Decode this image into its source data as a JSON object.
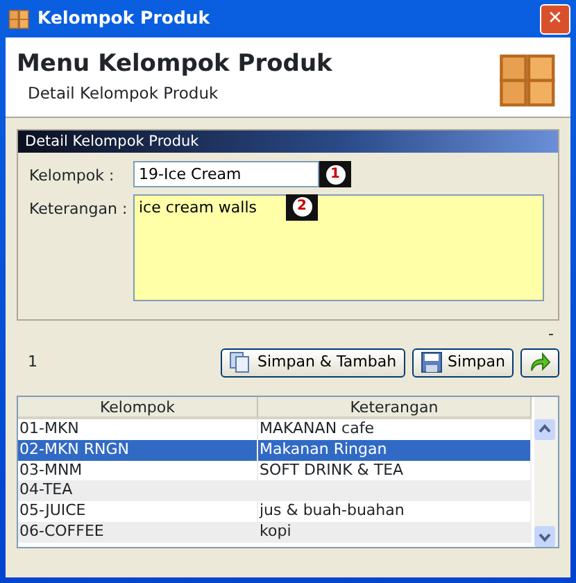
{
  "window": {
    "title": "Kelompok Produk",
    "close": "✕"
  },
  "header": {
    "title": "Menu Kelompok Produk",
    "subtitle": "Detail Kelompok Produk"
  },
  "panel": {
    "title": "Detail Kelompok Produk",
    "fields": [
      {
        "kind": "input",
        "label": "Kelompok :",
        "value": "19-Ice Cream",
        "marker": "1"
      },
      {
        "kind": "textarea",
        "label": "Keterangan :",
        "value": "ice cream walls",
        "marker": "2"
      }
    ]
  },
  "dash": "-",
  "count": "1",
  "buttons": [
    {
      "kind": "copy",
      "label": "Simpan & Tambah"
    },
    {
      "kind": "save",
      "label": "Simpan"
    },
    {
      "kind": "exit"
    }
  ],
  "table": {
    "columns": [
      "Kelompok",
      "Keterangan"
    ],
    "rows": [
      {
        "cells": [
          "01-MKN",
          "MAKANAN cafe"
        ],
        "selected": false
      },
      {
        "cells": [
          "02-MKN RNGN",
          "Makanan Ringan"
        ],
        "selected": true
      },
      {
        "cells": [
          "03-MNM",
          "SOFT DRINK & TEA"
        ],
        "selected": false
      },
      {
        "cells": [
          "04-TEA",
          ""
        ],
        "selected": false
      },
      {
        "cells": [
          "05-JUICE",
          "jus & buah-buahan"
        ],
        "selected": false
      },
      {
        "cells": [
          "06-COFFEE",
          "kopi"
        ],
        "selected": false
      }
    ]
  }
}
